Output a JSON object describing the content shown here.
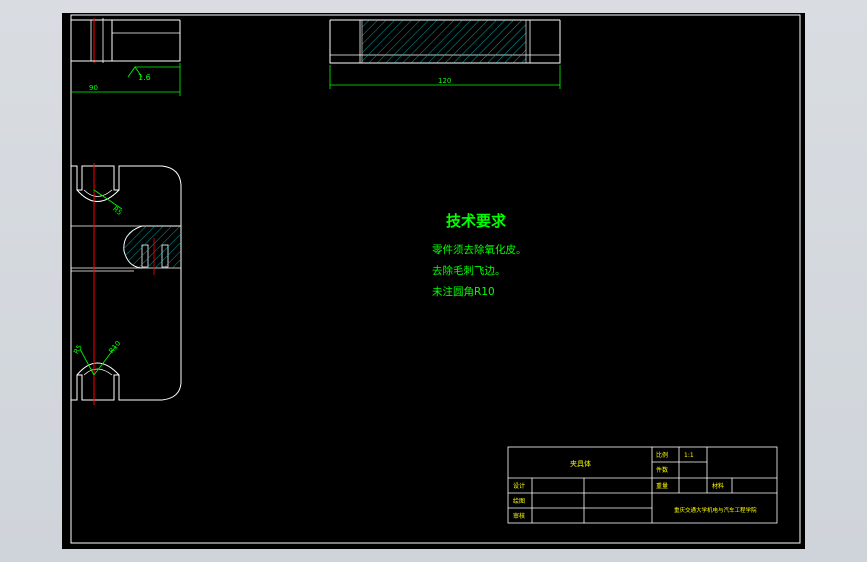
{
  "colors": {
    "background": "#000000",
    "outline": "#ffffff",
    "dimension": "#00ff00",
    "centerline": "#ff0000",
    "hatch": "#00c8c8",
    "note_text": "#00ff00",
    "title_text": "#ffff00"
  },
  "views": {
    "top_left": {
      "width_dim": "90",
      "roughness": "1.6"
    },
    "top_center": {
      "width_dim": "120"
    },
    "side": {
      "radius_dim": "R5",
      "radius_dim_2": "R10",
      "angle_label": "R5"
    }
  },
  "tech_notes": {
    "title": "技术要求",
    "items": [
      "零件须去除氧化皮。",
      "去除毛刺飞边。",
      "未注圆角R10"
    ]
  },
  "title_block": {
    "part_name": "夹具体",
    "scale_label": "比例",
    "scale_value": "1:1",
    "qty_label": "件数",
    "material_label": "重量",
    "sheet_label": "材料",
    "design_label": "设计",
    "draw_label": "绘图",
    "check_label": "审核",
    "school": "重庆交通大学机电与汽车工程学院"
  }
}
